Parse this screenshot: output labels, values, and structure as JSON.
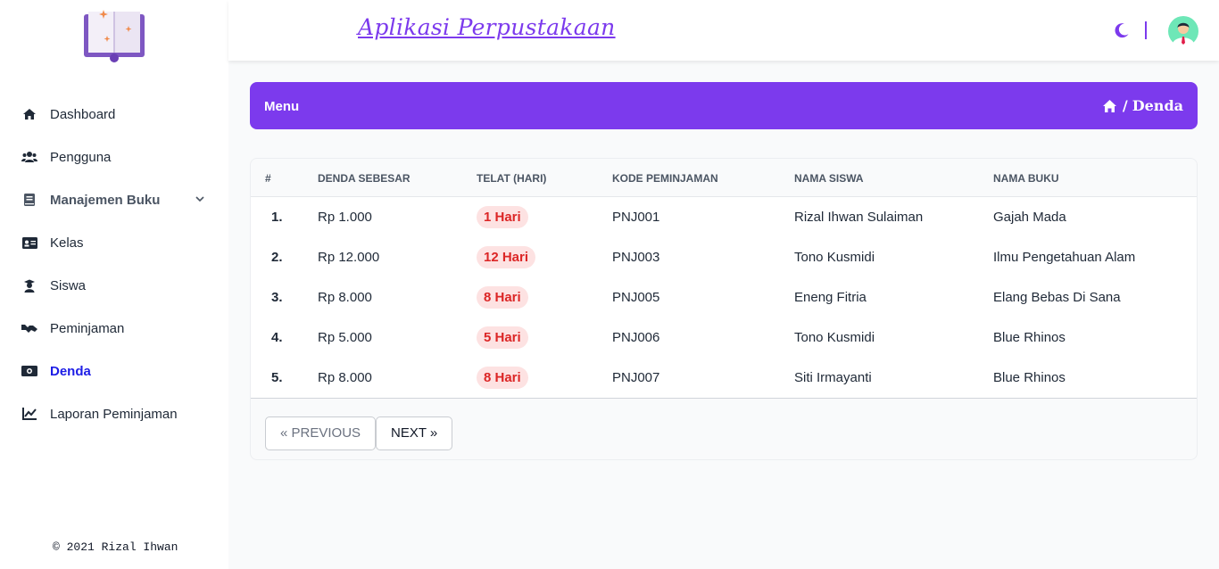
{
  "app": {
    "title": "Aplikasi Perpustakaan"
  },
  "sidebar": {
    "items": [
      {
        "label": "Dashboard",
        "icon": "home-icon"
      },
      {
        "label": "Pengguna",
        "icon": "users-icon"
      },
      {
        "label": "Manajemen Buku",
        "icon": "book-icon"
      },
      {
        "label": "Kelas",
        "icon": "id-card-icon"
      },
      {
        "label": "Siswa",
        "icon": "graduate-icon"
      },
      {
        "label": "Peminjaman",
        "icon": "handshake-icon"
      },
      {
        "label": "Denda",
        "icon": "money-icon"
      },
      {
        "label": "Laporan Peminjaman",
        "icon": "chart-line-icon"
      }
    ],
    "active": "Denda",
    "copyright": "© 2021 Rizal Ihwan"
  },
  "header": {
    "menu_label": "Menu",
    "breadcrumb_sep": "/",
    "breadcrumb_current": "Denda"
  },
  "table": {
    "columns": [
      "#",
      "DENDA SEBESAR",
      "TELAT (HARI)",
      "KODE PEMINJAMAN",
      "NAMA SISWA",
      "NAMA BUKU"
    ],
    "rows": [
      {
        "no": "1.",
        "denda": "Rp 1.000",
        "telat": "1 Hari",
        "kode": "PNJ001",
        "siswa": "Rizal Ihwan Sulaiman",
        "buku": "Gajah Mada"
      },
      {
        "no": "2.",
        "denda": "Rp 12.000",
        "telat": "12 Hari",
        "kode": "PNJ003",
        "siswa": "Tono Kusmidi",
        "buku": "Ilmu Pengetahuan Alam"
      },
      {
        "no": "3.",
        "denda": "Rp 8.000",
        "telat": "8 Hari",
        "kode": "PNJ005",
        "siswa": "Eneng Fitria",
        "buku": "Elang Bebas Di Sana"
      },
      {
        "no": "4.",
        "denda": "Rp 5.000",
        "telat": "5 Hari",
        "kode": "PNJ006",
        "siswa": "Tono Kusmidi",
        "buku": "Blue Rhinos"
      },
      {
        "no": "5.",
        "denda": "Rp 8.000",
        "telat": "8 Hari",
        "kode": "PNJ007",
        "siswa": "Siti Irmayanti",
        "buku": "Blue Rhinos"
      }
    ]
  },
  "pagination": {
    "prev_label": "« PREVIOUS",
    "next_label": "NEXT »"
  },
  "colors": {
    "accent": "#7c3aed",
    "active_nav": "#1d1de6",
    "badge_bg": "#fde2e2",
    "badge_text": "#dc2626"
  }
}
